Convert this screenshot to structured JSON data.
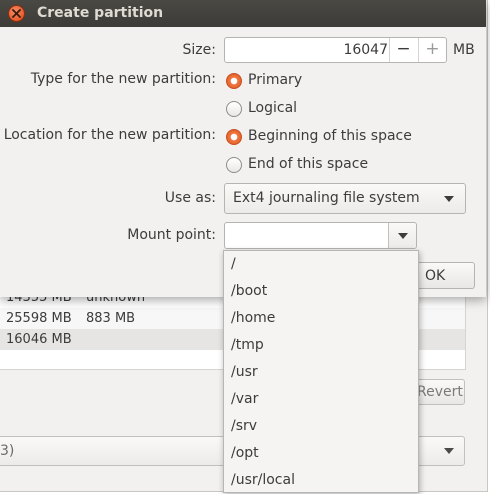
{
  "background": {
    "rows": [
      {
        "size": "14355 MB",
        "used": "unknown"
      },
      {
        "size": "25598 MB",
        "used": "883 MB"
      },
      {
        "size": "16046 MB",
        "used": ""
      }
    ],
    "revert_label": "Revert",
    "combo_fragment": "3)"
  },
  "dialog": {
    "title": "Create partition",
    "size_label": "Size:",
    "size_value": "16047",
    "size_minus": "−",
    "size_plus": "+",
    "size_unit": "MB",
    "type_label": "Type for the new partition:",
    "type_options": [
      {
        "label": "Primary",
        "selected": true
      },
      {
        "label": "Logical",
        "selected": false
      }
    ],
    "location_label": "Location for the new partition:",
    "location_options": [
      {
        "label": "Beginning of this space",
        "selected": true
      },
      {
        "label": "End of this space",
        "selected": false
      }
    ],
    "use_as_label": "Use as:",
    "use_as_value": "Ext4 journaling file system",
    "mount_label": "Mount point:",
    "mount_value": "",
    "ok_label": "OK"
  },
  "mount_options": [
    "/",
    "/boot",
    "/home",
    "/tmp",
    "/usr",
    "/var",
    "/srv",
    "/opt",
    "/usr/local"
  ],
  "colors": {
    "accent": "#e05d22",
    "titlebar": "#3c3b37",
    "window_bg": "#f2f1f0"
  }
}
